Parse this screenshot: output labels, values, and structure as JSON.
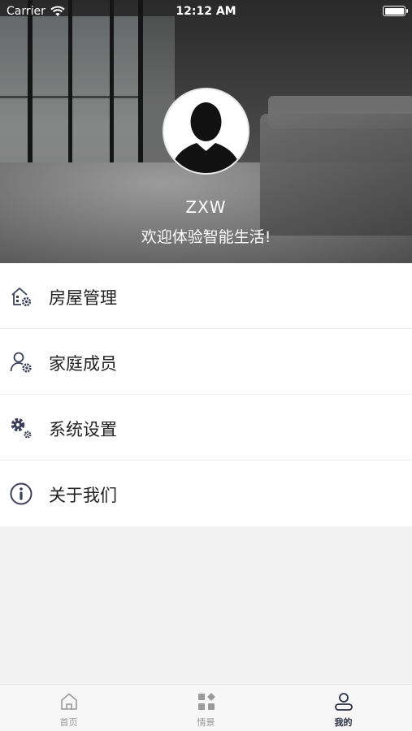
{
  "status_bar": {
    "carrier": "Carrier",
    "time": "12:12 AM"
  },
  "profile": {
    "username": "ZXW",
    "welcome": "欢迎体验智能生活!"
  },
  "menu": {
    "items": [
      {
        "label": "房屋管理",
        "icon": "house-settings-icon"
      },
      {
        "label": "家庭成员",
        "icon": "user-settings-icon"
      },
      {
        "label": "系统设置",
        "icon": "gears-icon"
      },
      {
        "label": "关于我们",
        "icon": "info-icon"
      }
    ]
  },
  "tabbar": {
    "tabs": [
      {
        "label": "首页",
        "icon": "home-icon",
        "active": false
      },
      {
        "label": "情景",
        "icon": "scenes-icon",
        "active": false
      },
      {
        "label": "我的",
        "icon": "profile-icon",
        "active": true
      }
    ]
  },
  "colors": {
    "icon": "#3b3f5a",
    "active_tab": "#2b2f45",
    "inactive_tab": "#9a9a9a"
  }
}
